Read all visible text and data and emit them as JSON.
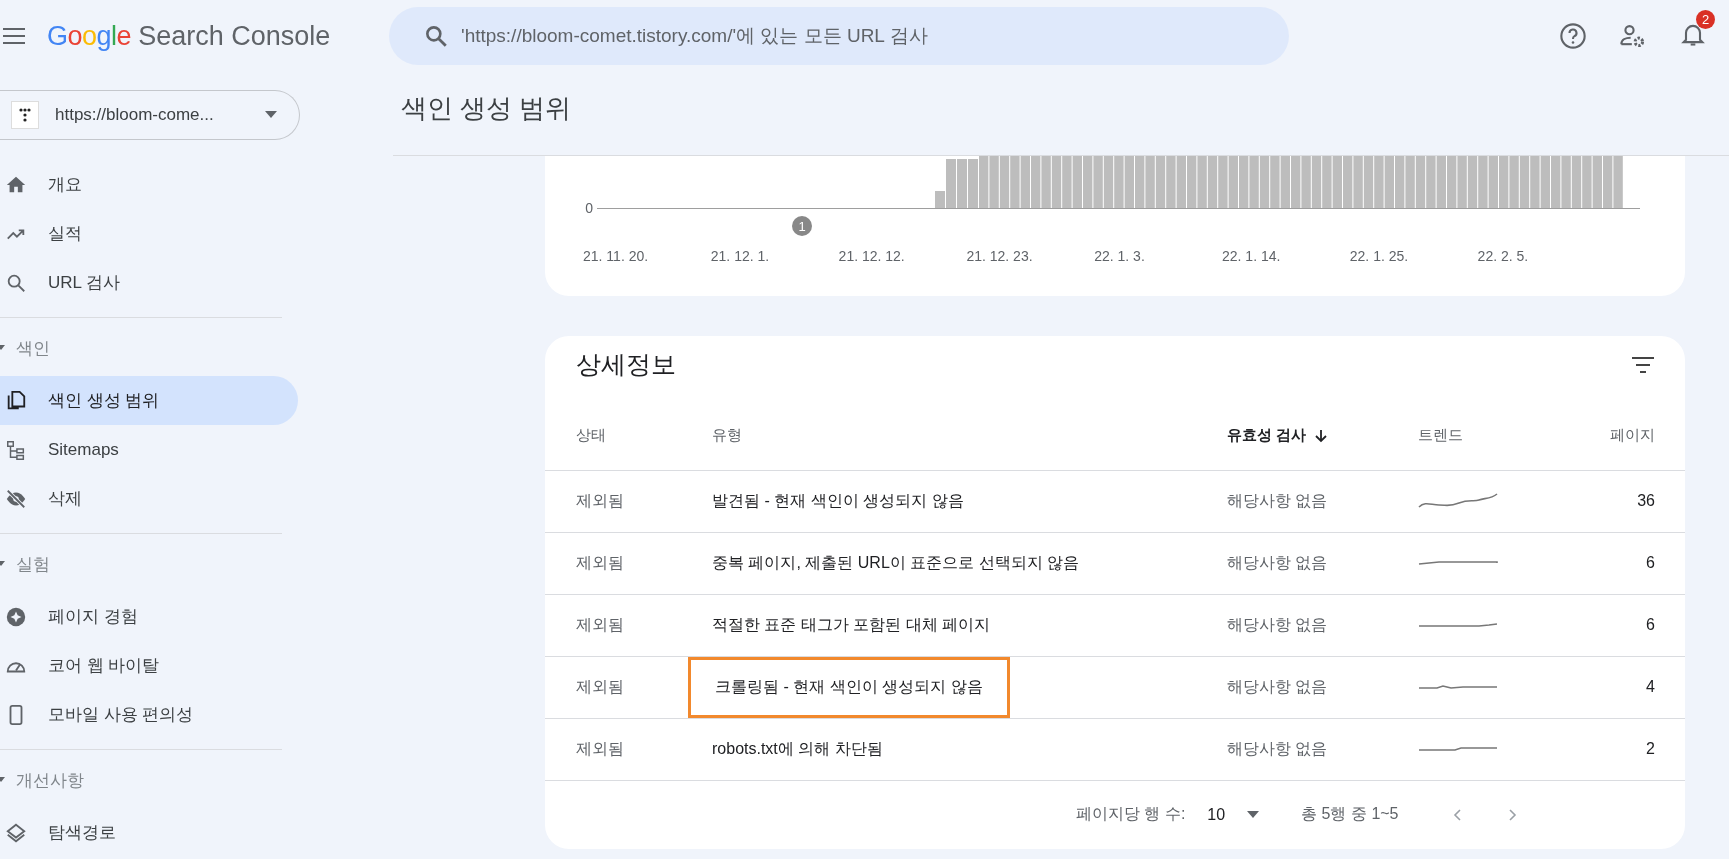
{
  "app": {
    "brand": "Google",
    "product": "Search Console"
  },
  "search": {
    "placeholder": "'https://bloom-comet.tistory.com/'에 있는 모든 URL 검사"
  },
  "notifications": {
    "count": "2"
  },
  "property": {
    "label": "https://bloom-come..."
  },
  "sidebar": {
    "groups": [
      {
        "items": [
          {
            "label": "개요",
            "selected": false
          },
          {
            "label": "실적",
            "selected": false
          },
          {
            "label": "URL 검사",
            "selected": false
          }
        ]
      },
      {
        "title": "색인",
        "expanded": true,
        "items": [
          {
            "label": "색인 생성 범위",
            "selected": true
          },
          {
            "label": "Sitemaps",
            "selected": false
          },
          {
            "label": "삭제",
            "selected": false
          }
        ]
      },
      {
        "title": "실험",
        "expanded": true,
        "items": [
          {
            "label": "페이지 경험",
            "selected": false
          },
          {
            "label": "코어 웹 바이탈",
            "selected": false
          },
          {
            "label": "모바일 사용 편의성",
            "selected": false
          }
        ]
      },
      {
        "title": "개선사항",
        "expanded": true,
        "items": [
          {
            "label": "탐색경로",
            "selected": false
          }
        ]
      }
    ]
  },
  "page": {
    "title": "색인 생성 범위"
  },
  "chart": {
    "y_tick": "0",
    "marker": "1",
    "x_labels": [
      "21. 11. 20.",
      "21. 12. 1.",
      "21. 12. 12.",
      "21. 12. 23.",
      "22. 1. 3.",
      "22. 1. 14.",
      "22. 1. 25.",
      "22. 2. 5."
    ]
  },
  "details": {
    "title": "상세정보",
    "columns": [
      {
        "label": "상태",
        "sorted": false
      },
      {
        "label": "유형",
        "sorted": false
      },
      {
        "label": "유효성 검사",
        "sorted": true
      },
      {
        "label": "트렌드",
        "sorted": false
      },
      {
        "label": "페이지",
        "sorted": false
      }
    ],
    "rows": [
      {
        "status": "제외됨",
        "type": "발견됨 - 현재 색인이 생성되지 않음",
        "validation": "해당사항 없음",
        "pages": "36",
        "highlighted": false
      },
      {
        "status": "제외됨",
        "type": "중복 페이지, 제출된 URL이 표준으로 선택되지 않음",
        "validation": "해당사항 없음",
        "pages": "6",
        "highlighted": false
      },
      {
        "status": "제외됨",
        "type": "적절한 표준 태그가 포함된 대체 페이지",
        "validation": "해당사항 없음",
        "pages": "6",
        "highlighted": false
      },
      {
        "status": "제외됨",
        "type": "크롤링됨 - 현재 색인이 생성되지 않음",
        "validation": "해당사항 없음",
        "pages": "4",
        "highlighted": true
      },
      {
        "status": "제외됨",
        "type": "robots.txt에 의해 차단됨",
        "validation": "해당사항 없음",
        "pages": "2",
        "highlighted": false
      }
    ],
    "pagination": {
      "rows_label": "페이지당 행 수:",
      "rows_value": "10",
      "range": "총 5행 중 1~5"
    }
  }
}
